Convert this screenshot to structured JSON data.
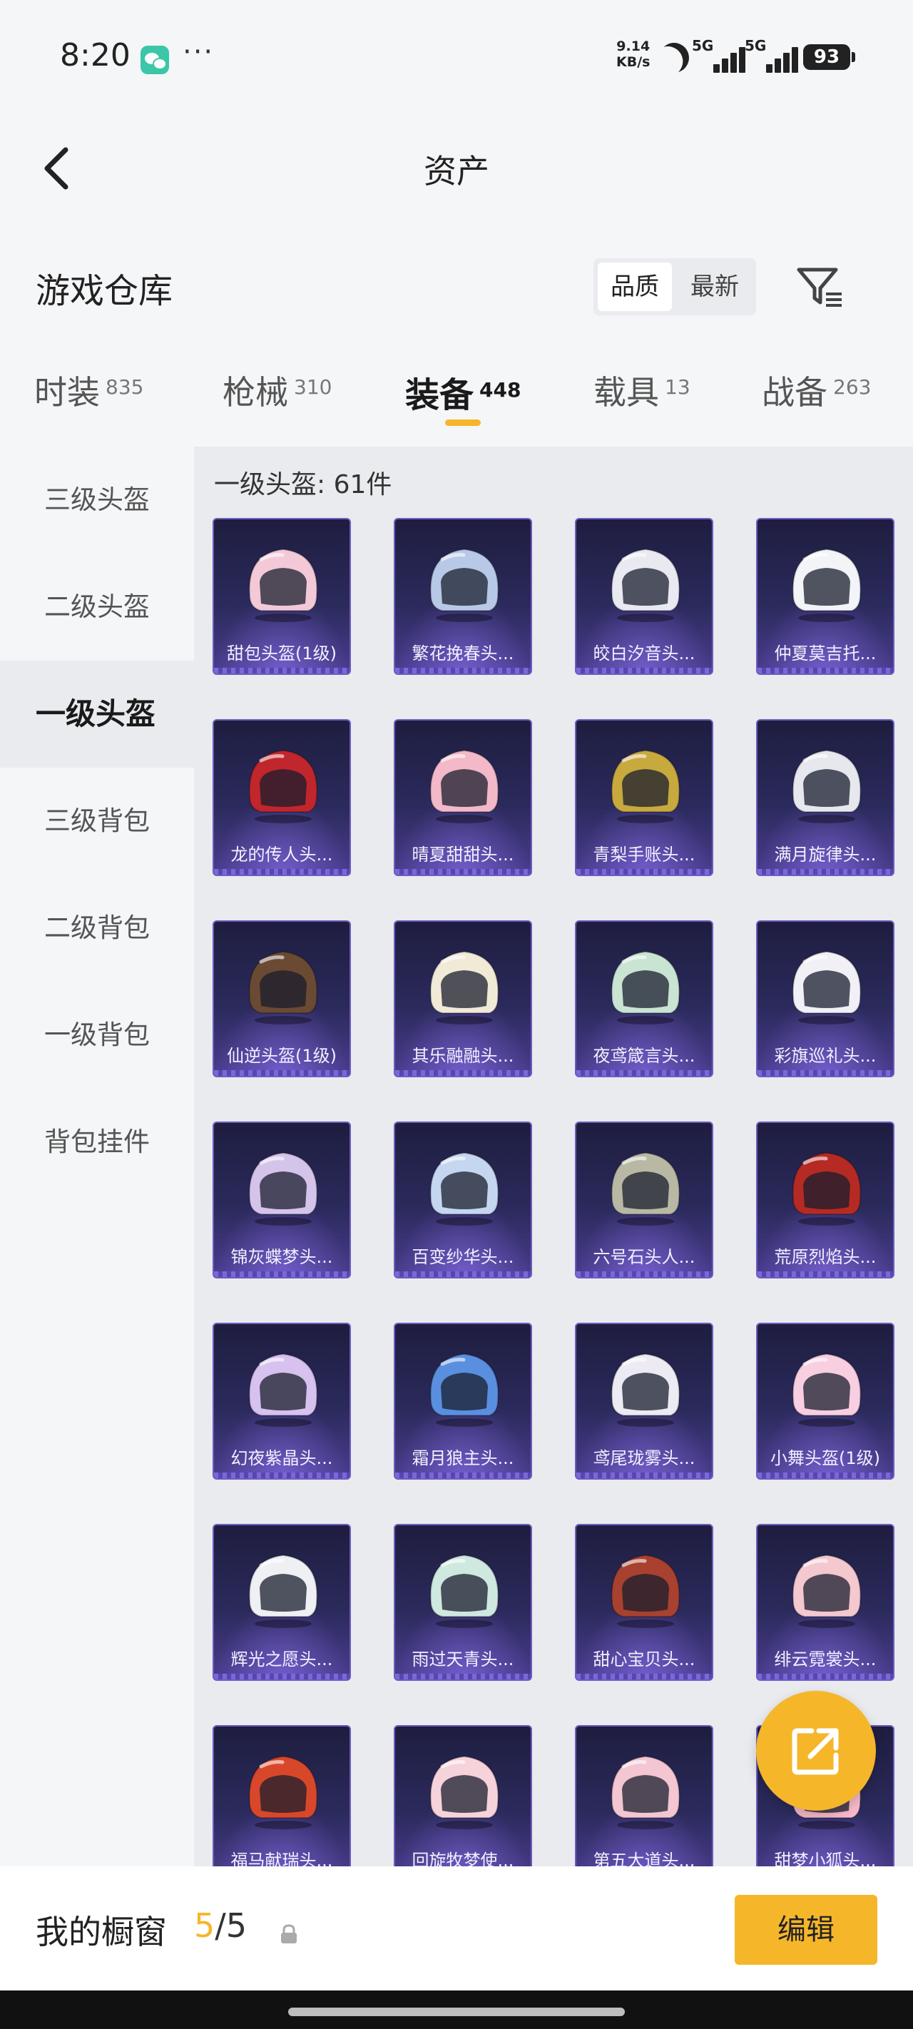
{
  "status_bar": {
    "time": "8:20",
    "more": "···",
    "net_speed_value": "9.14",
    "net_speed_unit": "KB/s",
    "sim1": "5G",
    "sim2": "5G",
    "battery": "93"
  },
  "nav": {
    "title": "资产",
    "back_icon": "chevron-left-icon"
  },
  "header": {
    "title": "游戏仓库",
    "sort_options": [
      "品质",
      "最新"
    ],
    "sort_active": "品质",
    "filter_icon": "filter-icon"
  },
  "tabs": [
    {
      "label": "时装",
      "count": "835"
    },
    {
      "label": "枪械",
      "count": "310"
    },
    {
      "label": "装备",
      "count": "448",
      "active": true
    },
    {
      "label": "载具",
      "count": "13"
    },
    {
      "label": "战备",
      "count": "263"
    }
  ],
  "sidebar": {
    "items": [
      "三级头盔",
      "二级头盔",
      "一级头盔",
      "三级背包",
      "二级背包",
      "一级背包",
      "背包挂件"
    ],
    "active": "一级头盔"
  },
  "grid": {
    "group_title": "一级头盔: 61件",
    "items": [
      {
        "name": "甜包头盔(1级)",
        "color": "#f3c9d8"
      },
      {
        "name": "繁花挽春头...",
        "color": "#b7c9e6"
      },
      {
        "name": "皎白汐音头...",
        "color": "#e9e9f2"
      },
      {
        "name": "仲夏莫吉托...",
        "color": "#f2f4f7"
      },
      {
        "name": "龙的传人头...",
        "color": "#c0262c"
      },
      {
        "name": "晴夏甜甜头...",
        "color": "#f3b9c8"
      },
      {
        "name": "青梨手账头...",
        "color": "#c7a93e"
      },
      {
        "name": "满月旋律头...",
        "color": "#e6e8ee"
      },
      {
        "name": "仙逆头盔(1级)",
        "color": "#6b4a33"
      },
      {
        "name": "其乐融融头...",
        "color": "#f1ead7"
      },
      {
        "name": "夜鸢箴言头...",
        "color": "#c9e4d2"
      },
      {
        "name": "彩旗巡礼头...",
        "color": "#f0f0f6"
      },
      {
        "name": "锦灰蝶梦头...",
        "color": "#d5c4ea"
      },
      {
        "name": "百变纱华头...",
        "color": "#c4d6f0"
      },
      {
        "name": "六号石头人...",
        "color": "#b9b8a4"
      },
      {
        "name": "荒原烈焰头...",
        "color": "#b52b24"
      },
      {
        "name": "幻夜紫晶头...",
        "color": "#d6c1ef"
      },
      {
        "name": "霜月狼主头...",
        "color": "#5a8fe0"
      },
      {
        "name": "鸢尾珑雾头...",
        "color": "#ecebf3"
      },
      {
        "name": "小舞头盔(1级)",
        "color": "#f7cfe0"
      },
      {
        "name": "辉光之愿头...",
        "color": "#eef0f4"
      },
      {
        "name": "雨过天青头...",
        "color": "#cfe8e0"
      },
      {
        "name": "甜心宝贝头...",
        "color": "#a8412f"
      },
      {
        "name": "绯云霓裳头...",
        "color": "#f4c8cf"
      },
      {
        "name": "福马献瑞头...",
        "color": "#d9472a"
      },
      {
        "name": "回旋牧梦使...",
        "color": "#f6d3da"
      },
      {
        "name": "第五大道头...",
        "color": "#f3c6d2"
      },
      {
        "name": "甜梦小狐头...",
        "color": "#f7b9c9"
      }
    ]
  },
  "share_icon": "share-external-icon",
  "bottom": {
    "label": "我的橱窗",
    "current": "5",
    "separator": "/",
    "total": "5",
    "lock_icon": "lock-icon",
    "edit": "编辑"
  },
  "colors": {
    "accent": "#f5b62a",
    "card_bg": "#2b2a5c"
  }
}
